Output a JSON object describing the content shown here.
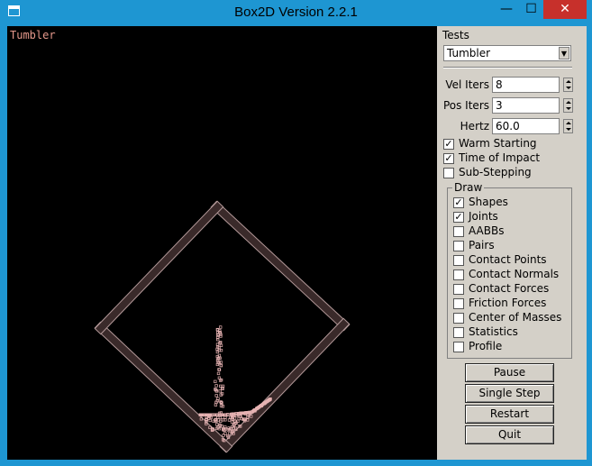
{
  "window": {
    "title": "Box2D Version 2.2.1",
    "caption_buttons": {
      "minimize": "—",
      "maximize": "☐",
      "close": "✕"
    }
  },
  "viewport": {
    "test_name": "Tumbler",
    "background": "#000000",
    "label_color": "#e6998c",
    "wall_color": "#b39999",
    "particle_color": "#e6b3b3"
  },
  "panel": {
    "tests_label": "Tests",
    "test_select_value": "Tumbler",
    "vel_iters": {
      "label": "Vel Iters",
      "value": "8"
    },
    "pos_iters": {
      "label": "Pos Iters",
      "value": "3"
    },
    "hertz": {
      "label": "Hertz",
      "value": "60.0"
    },
    "options": [
      {
        "label": "Warm Starting",
        "checked": true
      },
      {
        "label": "Time of Impact",
        "checked": true
      },
      {
        "label": "Sub-Stepping",
        "checked": false
      }
    ],
    "draw_label": "Draw",
    "draw_options": [
      {
        "label": "Shapes",
        "checked": true
      },
      {
        "label": "Joints",
        "checked": true
      },
      {
        "label": "AABBs",
        "checked": false
      },
      {
        "label": "Pairs",
        "checked": false
      },
      {
        "label": "Contact Points",
        "checked": false
      },
      {
        "label": "Contact Normals",
        "checked": false
      },
      {
        "label": "Contact Forces",
        "checked": false
      },
      {
        "label": "Friction Forces",
        "checked": false
      },
      {
        "label": "Center of Masses",
        "checked": false
      },
      {
        "label": "Statistics",
        "checked": false
      },
      {
        "label": "Profile",
        "checked": false
      }
    ],
    "buttons": {
      "pause": "Pause",
      "single_step": "Single Step",
      "restart": "Restart",
      "quit": "Quit"
    }
  }
}
